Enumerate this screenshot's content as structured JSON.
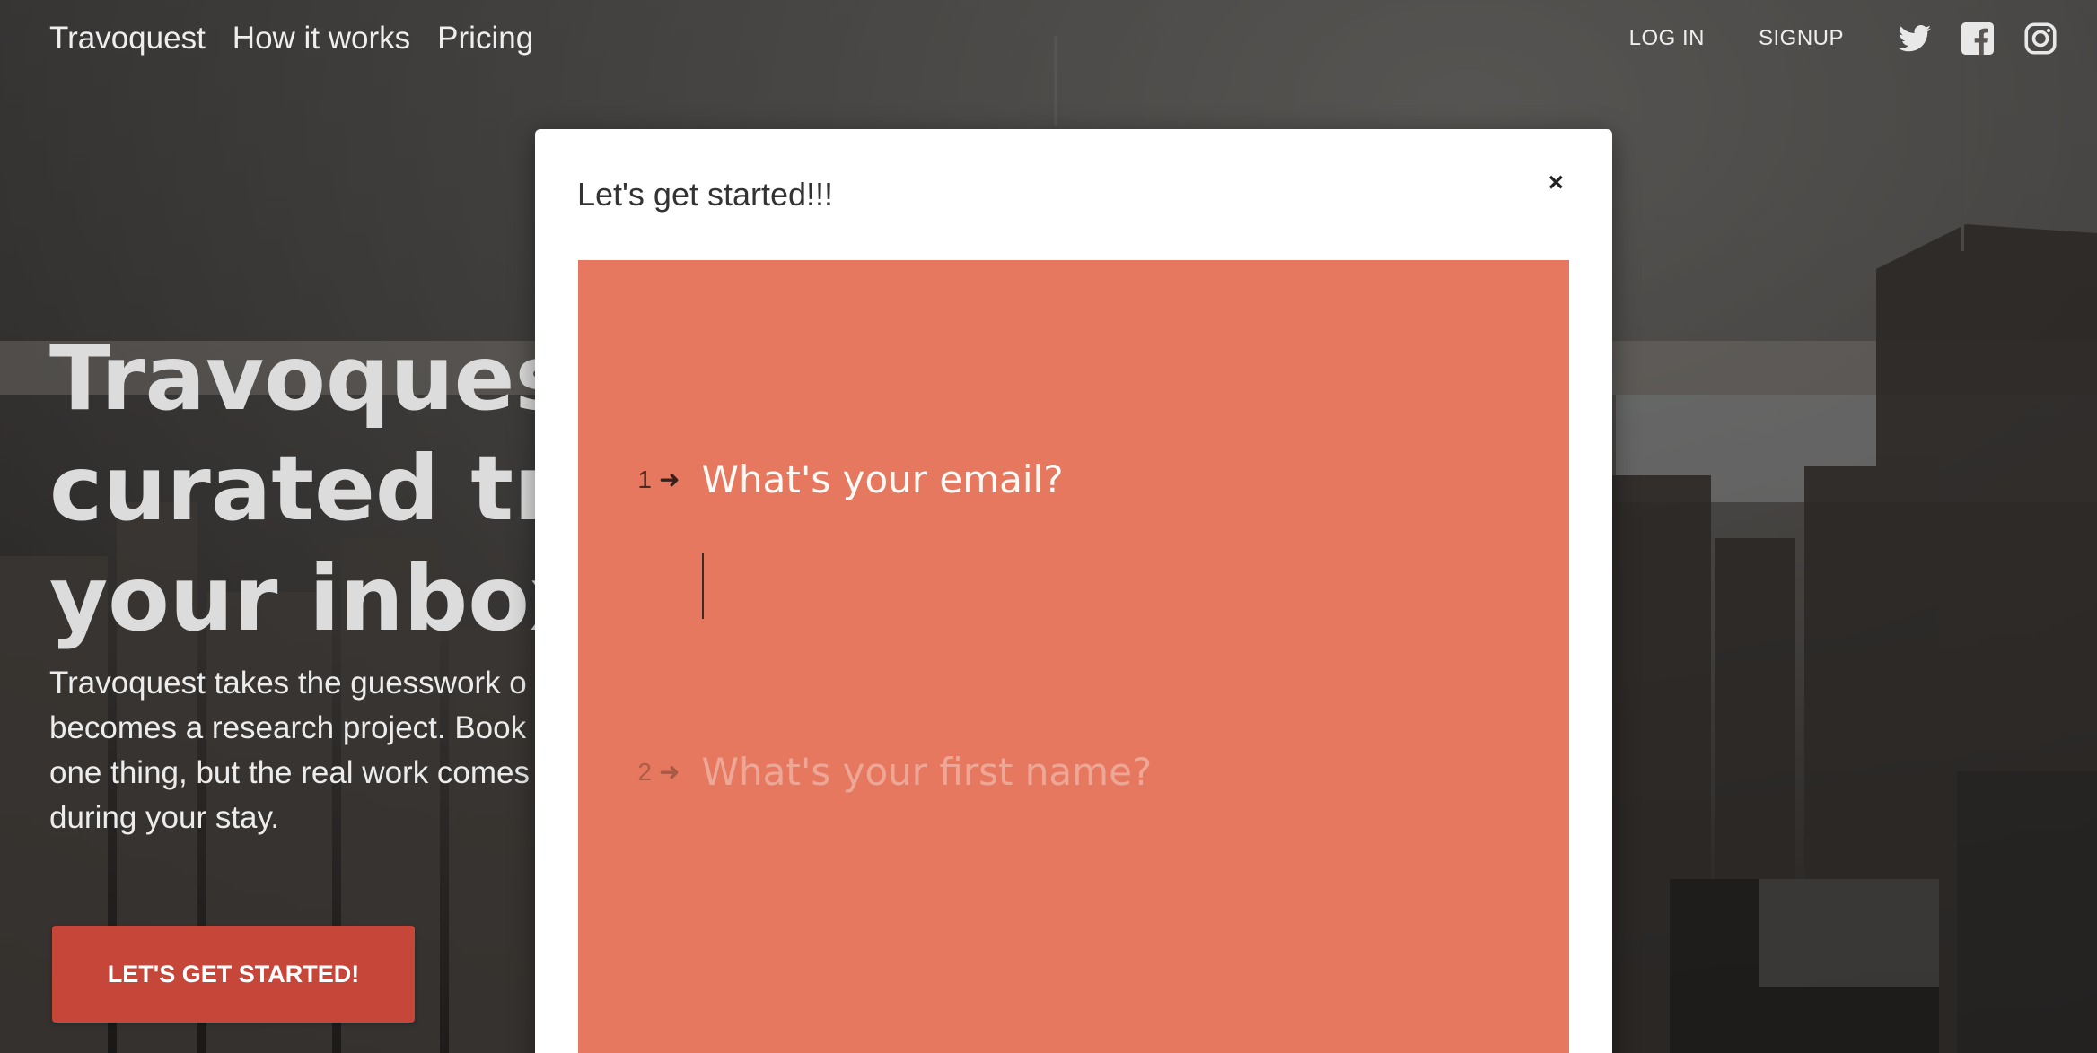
{
  "nav": {
    "links": [
      "Travoquest",
      "How it works",
      "Pricing"
    ],
    "login_label": "LOG IN",
    "signup_label": "SIGNUP",
    "social_icons": [
      "twitter-icon",
      "facebook-icon",
      "instagram-icon"
    ]
  },
  "hero": {
    "title_lines": [
      "Travoquest",
      "curated trav",
      "your inbox "
    ],
    "body": "Travoquest takes the guesswork o becomes a research project. Book one thing, but the real work comes during your stay.",
    "body_lines": [
      "Travoquest takes the guesswork o",
      "becomes a research project. Book",
      "one thing, but the real work comes",
      "during your stay."
    ],
    "cta_label": "LET'S GET STARTED!"
  },
  "modal": {
    "title": "Let's get started!!!",
    "close_label": "×",
    "questions": [
      {
        "number": "1",
        "arrow": "➜",
        "text": "What's your email?",
        "value": ""
      },
      {
        "number": "2",
        "arrow": "➜",
        "text": "What's your first name?"
      }
    ]
  },
  "colors": {
    "form_panel": "#e5785e",
    "cta": "#c6463a",
    "overlay_text": "#dcdcdc"
  }
}
